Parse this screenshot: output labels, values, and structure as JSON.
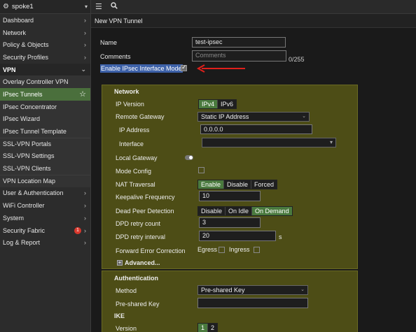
{
  "header": {
    "device": "spoke1"
  },
  "topbar": {
    "menu_icon": "hamburger-icon",
    "search_icon": "search-icon"
  },
  "page": {
    "title": "New VPN Tunnel"
  },
  "sidebar": {
    "items": [
      {
        "label": "Dashboard"
      },
      {
        "label": "Network"
      },
      {
        "label": "Policy & Objects"
      },
      {
        "label": "Security Profiles"
      },
      {
        "label": "VPN"
      },
      {
        "label": "Overlay Controller VPN"
      },
      {
        "label": "IPsec Tunnels"
      },
      {
        "label": "IPsec Concentrator"
      },
      {
        "label": "IPsec Wizard"
      },
      {
        "label": "IPsec Tunnel Template"
      },
      {
        "label": "SSL-VPN Portals"
      },
      {
        "label": "SSL-VPN Settings"
      },
      {
        "label": "SSL-VPN Clients"
      },
      {
        "label": "VPN Location Map"
      },
      {
        "label": "User & Authentication"
      },
      {
        "label": "WiFi Controller"
      },
      {
        "label": "System"
      },
      {
        "label": "Security Fabric",
        "badge": "1"
      },
      {
        "label": "Log & Report"
      }
    ]
  },
  "form": {
    "name_label": "Name",
    "name_value": "test-ipsec",
    "comments_label": "Comments",
    "comments_placeholder": "Comments",
    "comments_counter": "0/255",
    "ipsec_mode_label": "Enable IPsec Interface Mode",
    "ipsec_mode_checked": true
  },
  "network": {
    "title": "Network",
    "ip_version_label": "IP Version",
    "ip_versions": [
      "IPv4",
      "IPv6"
    ],
    "remote_gateway_label": "Remote Gateway",
    "remote_gateway_value": "Static IP Address",
    "ip_address_label": "IP Address",
    "ip_address_value": "0.0.0.0",
    "interface_label": "Interface",
    "local_gateway_label": "Local Gateway",
    "mode_config_label": "Mode Config",
    "nat_traversal_label": "NAT Traversal",
    "nat_options": [
      "Enable",
      "Disable",
      "Forced"
    ],
    "keepalive_label": "Keepalive Frequency",
    "keepalive_value": "10",
    "dpd_label": "Dead Peer Detection",
    "dpd_options": [
      "Disable",
      "On Idle",
      "On Demand"
    ],
    "dpd_retry_count_label": "DPD retry count",
    "dpd_retry_count_value": "3",
    "dpd_retry_interval_label": "DPD retry interval",
    "dpd_retry_interval_value": "20",
    "dpd_retry_interval_unit": "s",
    "fec_label": "Forward Error Correction",
    "fec_egress_label": "Egress",
    "fec_ingress_label": "Ingress",
    "advanced_label": "Advanced..."
  },
  "authentication": {
    "title": "Authentication",
    "method_label": "Method",
    "method_value": "Pre-shared Key",
    "psk_label": "Pre-shared Key",
    "ike_label": "IKE",
    "version_label": "Version",
    "versions": [
      "1",
      "2"
    ]
  },
  "colors": {
    "active": "#4a6f3c",
    "panel": "#4d4d16",
    "highlight": "#3d61a8",
    "arrow": "#e0201b"
  }
}
